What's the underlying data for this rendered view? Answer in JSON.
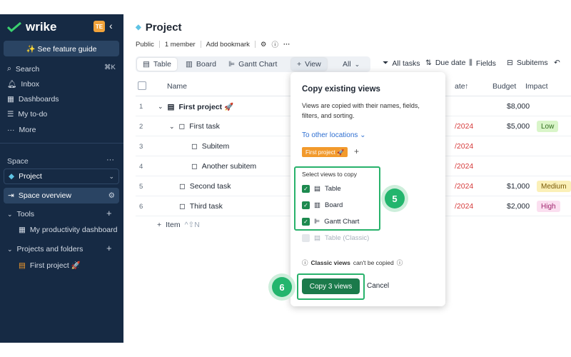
{
  "sidebar": {
    "brand": "wrike",
    "workspace_initials": "TE",
    "feature_guide": "✨ See feature guide",
    "nav": [
      {
        "label": "Search",
        "icon": "search-icon",
        "shortcut": "⌘K"
      },
      {
        "label": "Inbox",
        "icon": "bell-icon"
      },
      {
        "label": "Dashboards",
        "icon": "dashboard-icon"
      },
      {
        "label": "My to-do",
        "icon": "todo-icon"
      },
      {
        "label": "More",
        "icon": "more-icon"
      }
    ],
    "space_label": "Space",
    "space_selected": "Project",
    "space_overview": "Space overview",
    "tools_label": "Tools",
    "tools_item": "My productivity dashboard",
    "projects_label": "Projects and folders",
    "project_item": "First project 🚀"
  },
  "header": {
    "title": "Project",
    "meta": [
      "Public",
      "1 member",
      "Add bookmark"
    ]
  },
  "tabs": [
    {
      "label": "Table",
      "icon": "table-icon"
    },
    {
      "label": "Board",
      "icon": "board-icon"
    },
    {
      "label": "Gantt Chart",
      "icon": "gantt-icon"
    },
    {
      "label": "View",
      "icon": "plus-icon"
    },
    {
      "label": "All",
      "icon": "chevron-down-icon"
    }
  ],
  "toolbar": {
    "all_tasks": "All tasks",
    "due_date": "Due date",
    "fields": "Fields",
    "subitems": "Subitems"
  },
  "table": {
    "headers": {
      "name": "Name",
      "date": "ate",
      "budget": "Budget",
      "impact": "Impact"
    },
    "rows": [
      {
        "num": "1",
        "name": "First project 🚀",
        "date": "",
        "budget": "$8,000",
        "impact": ""
      },
      {
        "num": "2",
        "name": "First task",
        "date": "/2024",
        "budget": "$5,000",
        "impact": "Low"
      },
      {
        "num": "3",
        "name": "Subitem",
        "date": "/2024",
        "budget": "",
        "impact": ""
      },
      {
        "num": "4",
        "name": "Another subitem",
        "date": "/2024",
        "budget": "",
        "impact": ""
      },
      {
        "num": "5",
        "name": "Second task",
        "date": "/2024",
        "budget": "$1,000",
        "impact": "Medium"
      },
      {
        "num": "6",
        "name": "Third task",
        "date": "/2024",
        "budget": "$2,000",
        "impact": "High"
      }
    ],
    "add_item": "Item",
    "add_item_shortcut": "^⇧N"
  },
  "popup": {
    "title": "Copy existing views",
    "description": "Views are copied with their names, fields, filters, and sorting.",
    "location_link": "To other locations",
    "location_chip": "First project 🚀",
    "select_label": "Select views to copy",
    "views": [
      {
        "label": "Table",
        "checked": true
      },
      {
        "label": "Board",
        "checked": true
      },
      {
        "label": "Gantt Chart",
        "checked": true
      },
      {
        "label": "Table (Classic)",
        "checked": false
      }
    ],
    "note_bold": "Classic views",
    "note_rest": "can't be copied",
    "copy_button": "Copy 3 views",
    "cancel_button": "Cancel"
  },
  "steps": {
    "five": "5",
    "six": "6"
  },
  "colors": {
    "sidebar": "#162a44",
    "accent_green": "#1b7a4b",
    "highlight_green": "#28b26b",
    "link_blue": "#2e6fd1"
  }
}
